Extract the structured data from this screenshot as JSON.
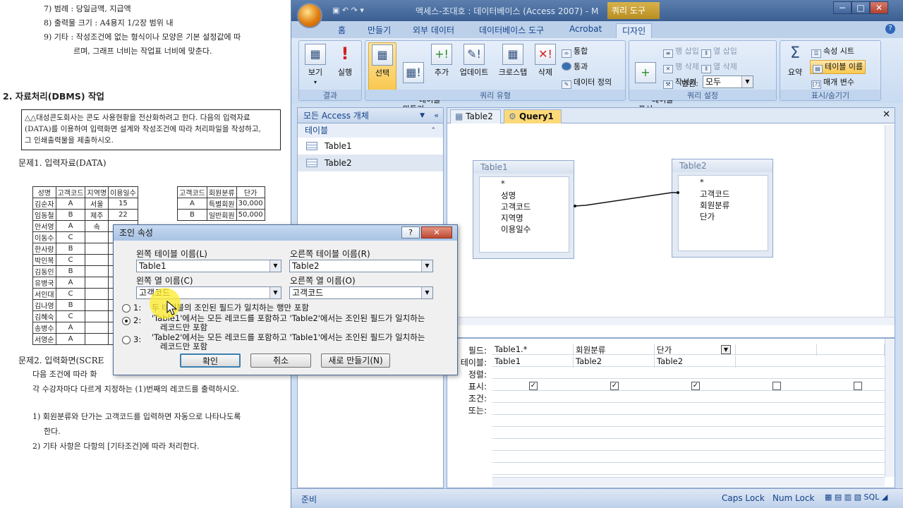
{
  "doc": {
    "lines_top": [
      "7) 범례 : 당일금액, 지급액",
      "8) 출력물 크기 : A4용지 1/2장 범위 내",
      "9) 기타 : 작성조건에 없는 형식이나 모양은 기본 설정값에 따",
      "르며, 그래프 너비는 작업표 너비에 맞춘다."
    ],
    "section_title": "2. 자료처리(DBMS) 작업",
    "box_text": [
      "△△대성콘도회사는 콘도 사용현황을 전산화하려고 한다. 다음의 입력자료",
      "(DATA)를 이용하여 입력화면 설계와 작성조건에 따라 처리파일을 작성하고,",
      "그 인쇄출력물을 제출하시오."
    ],
    "q1": "문제1. 입력자료(DATA)",
    "table1_headers": [
      "성명",
      "고객코드",
      "지역명",
      "이용일수"
    ],
    "table1_rows": [
      [
        "김순자",
        "A",
        "서울",
        "15"
      ],
      [
        "임동철",
        "B",
        "제주",
        "22"
      ],
      [
        "안서영",
        "A",
        "속",
        ""
      ],
      [
        "이동수",
        "C",
        "",
        ""
      ],
      [
        "한사랑",
        "B",
        "",
        ""
      ],
      [
        "박인복",
        "C",
        "",
        ""
      ],
      [
        "김동인",
        "B",
        "",
        ""
      ],
      [
        "유병국",
        "A",
        "",
        ""
      ],
      [
        "서인대",
        "C",
        "",
        ""
      ],
      [
        "김나영",
        "B",
        "",
        ""
      ],
      [
        "김혜숙",
        "C",
        "",
        ""
      ],
      [
        "송병수",
        "A",
        "",
        ""
      ],
      [
        "서영순",
        "A",
        "",
        ""
      ]
    ],
    "table2_headers": [
      "고객코드",
      "회원분류",
      "단가"
    ],
    "table2_rows": [
      [
        "A",
        "특별회원",
        "30,000"
      ],
      [
        "B",
        "일반회원",
        "50,000"
      ]
    ],
    "q2": "문제2. 입력화면(SCRE",
    "q2_lines": [
      "다음 조건에 따라 화",
      "각 수강자마다 다르게 지정하는 (1)번째의 레코드를 출력하시오."
    ],
    "conds": [
      "1) 회원분류와 단가는 고객코드를 입력하면 자동으로 나타나도록",
      "한다.",
      "2) 기타 사항은 다항의 [기타조건]에 따라 처리한다."
    ]
  },
  "window": {
    "title": "액세스-조대호 : 데이터베이스 (Access 2007) - M",
    "context_title": "쿼리 도구",
    "tabs": [
      "홈",
      "만들기",
      "외부 데이터",
      "데이터베이스 도구",
      "Acrobat",
      "디자인"
    ],
    "active_tab": "디자인"
  },
  "ribbon": {
    "group_result": {
      "label": "결과",
      "view": "보기",
      "run": "실행"
    },
    "group_type": {
      "label": "쿼리 유형",
      "select": "선택",
      "make_table": "테이블\n만들기",
      "append": "추가",
      "update": "업데이트",
      "crosstab": "크로스탭",
      "delete": "삭제",
      "union": "통합",
      "pass_through": "통과",
      "data_def": "데이터 정의"
    },
    "group_setup": {
      "label": "쿼리 설정",
      "show_table": "테이블\n표시",
      "insert_row": "행 삽입",
      "delete_row": "행 삭제",
      "builder": "작성기",
      "insert_col": "열 삽입",
      "delete_col": "열 삭제",
      "return_label": "반환:",
      "return_value": "모두"
    },
    "group_show": {
      "label": "표시/숨기기",
      "totals": "요약",
      "property_sheet": "속성 시트",
      "table_names": "테이블 이름",
      "parameters": "매개 변수"
    }
  },
  "nav": {
    "header": "모든 Access 개체",
    "section": "테이블",
    "items": [
      "Table1",
      "Table2"
    ]
  },
  "doc_tabs": [
    "Table2",
    "Query1"
  ],
  "tables": {
    "t1": {
      "name": "Table1",
      "fields": [
        "*",
        "성명",
        "고객코드",
        "지역명",
        "이용일수"
      ]
    },
    "t2": {
      "name": "Table2",
      "fields": [
        "*",
        "고객코드",
        "회원분류",
        "단가"
      ]
    }
  },
  "grid": {
    "labels": [
      "필드:",
      "테이블:",
      "정렬:",
      "표시:",
      "조건:",
      "또는:"
    ],
    "fields": [
      "Table1.*",
      "회원분류",
      "단가"
    ],
    "tables": [
      "Table1",
      "Table2",
      "Table2"
    ],
    "show_checks": [
      true,
      true,
      true,
      false,
      false
    ]
  },
  "status": {
    "left": "준비",
    "caps": "Caps Lock",
    "num": "Num Lock"
  },
  "dialog": {
    "title": "조인 속성",
    "left_table_label": "왼쪽 테이블 이름(L)",
    "right_table_label": "오른쪽 테이블 이름(R)",
    "left_table_value": "Table1",
    "right_table_value": "Table2",
    "left_col_label": "왼쪽 열 이름(C)",
    "right_col_label": "오른쪽 열 이름(O)",
    "left_col_value": "고객코드",
    "right_col_value": "고객코드",
    "opt1_num": "1:",
    "opt1": "두 테이블의 조인된 필드가 일치하는 행만 포함",
    "opt2_num": "2:",
    "opt2_a": "'Table1'에서는 모든 레코드를 포함하고 'Table2'에서는 조인된 필드가 일치하는",
    "opt2_b": "레코드만 포함",
    "opt3_num": "3:",
    "opt3_a": "'Table2'에서는 모든 레코드를 포함하고 'Table1'에서는 조인된 필드가 일치하는",
    "opt3_b": "레코드만 포함",
    "ok": "확인",
    "cancel": "취소",
    "new": "새로 만들기(N)",
    "selected_option": 2
  }
}
